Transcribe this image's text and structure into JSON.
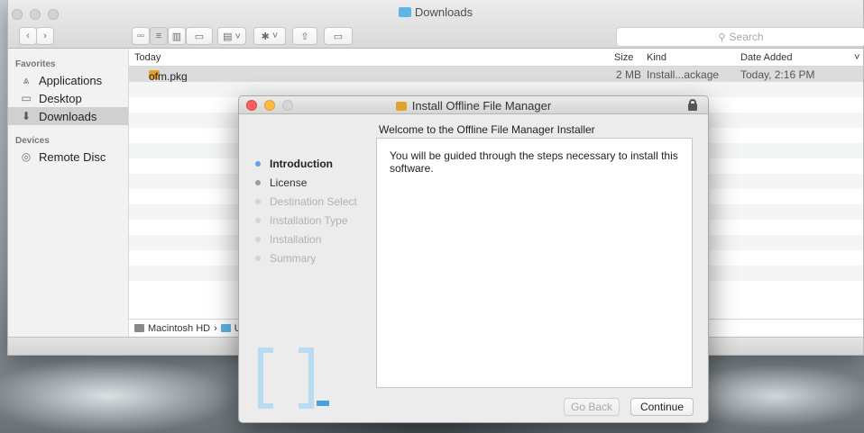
{
  "finder": {
    "title": "Downloads",
    "search_placeholder": "Search",
    "sidebar": {
      "favorites_heading": "Favorites",
      "items": [
        {
          "label": "Applications"
        },
        {
          "label": "Desktop"
        },
        {
          "label": "Downloads"
        }
      ],
      "devices_heading": "Devices",
      "devices": [
        {
          "label": "Remote Disc"
        }
      ]
    },
    "columns": {
      "name": "Today",
      "size": "Size",
      "kind": "Kind",
      "date": "Date Added"
    },
    "files": [
      {
        "name": "ofm.pkg",
        "size": "2 MB",
        "kind": "Install...ackage",
        "date": "Today, 2:16 PM"
      }
    ],
    "pathbar": {
      "disk": "Macintosh HD",
      "separator": "›",
      "next": "U"
    }
  },
  "installer": {
    "title": "Install Offline File Manager",
    "heading": "Welcome to the Offline File Manager Installer",
    "steps": [
      {
        "label": "Introduction",
        "state": "active"
      },
      {
        "label": "License",
        "state": "next"
      },
      {
        "label": "Destination Select",
        "state": "pending"
      },
      {
        "label": "Installation Type",
        "state": "pending"
      },
      {
        "label": "Installation",
        "state": "pending"
      },
      {
        "label": "Summary",
        "state": "pending"
      }
    ],
    "body": "You will be guided through the steps necessary to install this software.",
    "buttons": {
      "back": "Go Back",
      "continue": "Continue"
    },
    "accent_color": "#5aa5e8",
    "logo_color": "#b9dcf3"
  }
}
